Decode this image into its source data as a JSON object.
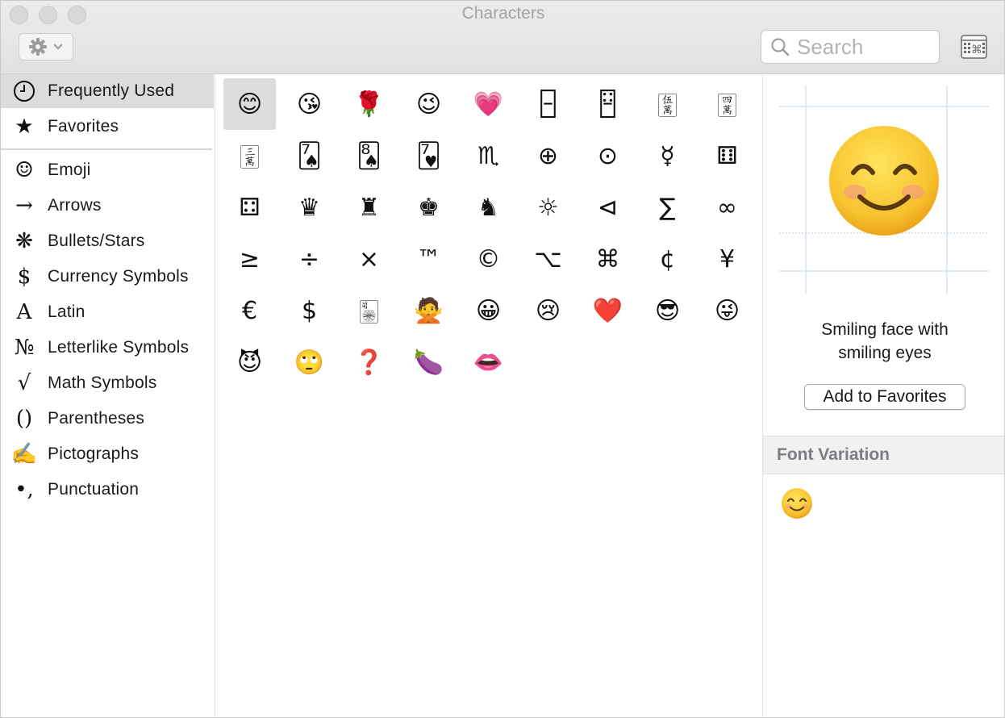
{
  "window": {
    "title": "Characters"
  },
  "toolbar": {
    "search_placeholder": "Search"
  },
  "sidebar": {
    "items": [
      {
        "icon": "clock-icon",
        "glyph": "",
        "label": "Frequently Used"
      },
      {
        "icon": "star-icon",
        "glyph": "★",
        "label": "Favorites"
      },
      {
        "icon": "smiley-outline-icon",
        "glyph": "☺",
        "label": "Emoji"
      },
      {
        "icon": "arrow-right-icon",
        "glyph": "→",
        "label": "Arrows"
      },
      {
        "icon": "asterisk-icon",
        "glyph": "❋",
        "label": "Bullets/Stars"
      },
      {
        "icon": "dollar-icon",
        "glyph": "$",
        "label": "Currency Symbols"
      },
      {
        "icon": "latin-a-icon",
        "glyph": "A",
        "label": "Latin"
      },
      {
        "icon": "numero-icon",
        "glyph": "№",
        "label": "Letterlike Symbols"
      },
      {
        "icon": "square-root-icon",
        "glyph": "√",
        "label": "Math Symbols"
      },
      {
        "icon": "parentheses-icon",
        "glyph": "()",
        "label": "Parentheses"
      },
      {
        "icon": "pen-icon",
        "glyph": "✍",
        "label": "Pictographs"
      },
      {
        "icon": "punctuation-icon",
        "glyph": "•,",
        "label": "Punctuation"
      }
    ],
    "selected_index": 0
  },
  "grid": {
    "columns": 9,
    "selected_index": 0,
    "characters": [
      "😊",
      "😘",
      "🌹",
      "😉",
      "💗",
      "🁣",
      "🁿",
      "🀋",
      "🀊",
      "🀉",
      "🂧",
      "🂨",
      "🂷",
      "♏",
      "⊕",
      "⊙",
      "☿",
      "⚅",
      "⚃",
      "♛",
      "♜",
      "♚",
      "♞",
      "☼",
      "⊲",
      "∑",
      "∞",
      "≥",
      "÷",
      "×",
      "™",
      "©",
      "⌥",
      "⌘",
      "¢",
      "¥",
      "€",
      "$",
      "🀥",
      "🙅",
      "😀",
      "😢",
      "❤️",
      "😎",
      "😜",
      "😈",
      "🙄",
      "❓",
      "🍆",
      "👄"
    ]
  },
  "detail": {
    "preview_character": "😊",
    "character_name": "Smiling face with smiling eyes",
    "add_to_favorites_label": "Add to Favorites",
    "font_variation_header": "Font Variation",
    "font_variations": [
      "😊"
    ]
  },
  "colors": {
    "selection": "#dcdcdc",
    "title_text": "#a3a3a3",
    "font_variation_header_text": "#7c7c84",
    "emoji_face": "#f8c22e",
    "emoji_cheek": "#f49486"
  }
}
